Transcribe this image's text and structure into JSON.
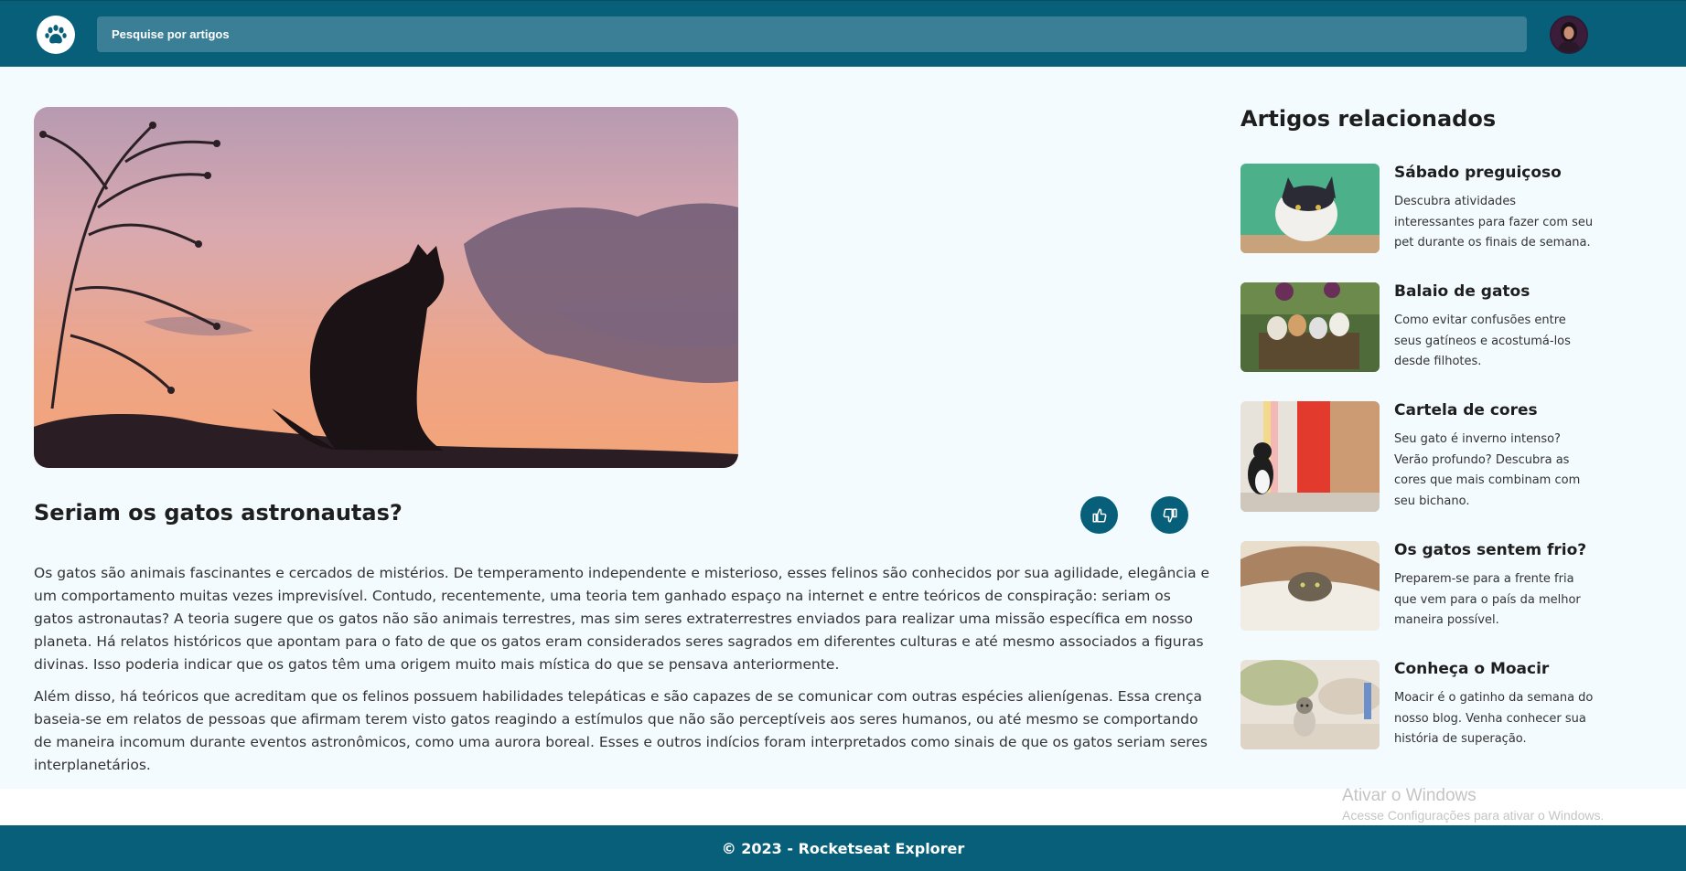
{
  "header": {
    "search": {
      "placeholder": "Pesquise por artigos"
    }
  },
  "article": {
    "title": "Seriam os gatos astronautas?",
    "paragraphs": [
      "Os gatos são animais fascinantes e cercados de mistérios. De temperamento independente e misterioso, esses felinos são conhecidos por sua agilidade, elegância e um comportamento muitas vezes imprevisível. Contudo, recentemente, uma teoria tem ganhado espaço na internet e entre teóricos de conspiração: seriam os gatos astronautas? A teoria sugere que os gatos não são animais terrestres, mas sim seres extraterrestres enviados para realizar uma missão específica em nosso planeta. Há relatos históricos que apontam para o fato de que os gatos eram considerados seres sagrados em diferentes culturas e até mesmo associados a figuras divinas. Isso poderia indicar que os gatos têm uma origem muito mais mística do que se pensava anteriormente.",
      "Além disso, há teóricos que acreditam que os felinos possuem habilidades telepáticas e são capazes de se comunicar com outras espécies alienígenas. Essa crença baseia-se em relatos de pessoas que afirmam terem visto gatos reagindo a estímulos que não são perceptíveis aos seres humanos, ou até mesmo se comportando de maneira incomum durante eventos astronômicos, como uma aurora boreal. Esses e outros indícios foram interpretados como sinais de que os gatos seriam seres interplanetários."
    ]
  },
  "related": {
    "title": "Artigos relacionados",
    "items": [
      {
        "title": "Sábado preguiçoso",
        "description": "Descubra atividades interessantes para fazer com seu pet durante os finais de semana."
      },
      {
        "title": "Balaio de gatos",
        "description": "Como evitar confusões entre seus gatíneos e acostumá-los desde filhotes."
      },
      {
        "title": "Cartela de cores",
        "description": "Seu gato é inverno intenso? Verão profundo? Descubra as cores que mais combinam com seu bichano."
      },
      {
        "title": "Os gatos sentem frio?",
        "description": "Preparem-se para a frente fria que vem para o país da melhor maneira possível."
      },
      {
        "title": "Conheça o Moacir",
        "description": "Moacir é o gatinho da semana do nosso blog. Venha conhecer sua história de superação."
      }
    ]
  },
  "footer": {
    "text": "© 2023 - Rocketseat Explorer"
  },
  "watermark": {
    "line1": "Ativar o Windows",
    "line2": "Acesse Configurações para ativar o Windows."
  },
  "colors": {
    "primary": "#075f7a",
    "search_bg": "#3a7f96",
    "page_bg": "#f3fbff"
  },
  "icons": {
    "logo": "paw-icon",
    "like": "thumbs-up-icon",
    "dislike": "thumbs-down-icon"
  }
}
